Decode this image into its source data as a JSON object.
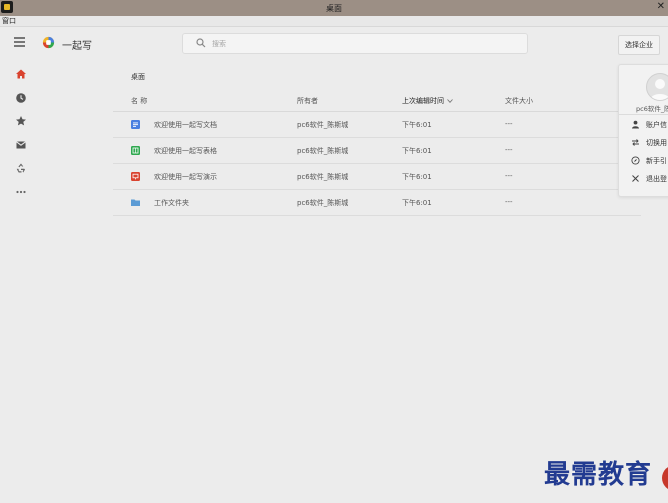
{
  "window": {
    "title": "桌面"
  },
  "menubar": {
    "items": [
      "窗口"
    ]
  },
  "header": {
    "app_name": "一起写",
    "search_placeholder": "搜索",
    "select_company_label": "选择企业"
  },
  "rail": {
    "items": [
      {
        "icon": "home-icon",
        "color": "#d9432f"
      },
      {
        "icon": "clock-icon",
        "color": "#555555"
      },
      {
        "icon": "star-icon",
        "color": "#555555"
      },
      {
        "icon": "mail-icon",
        "color": "#555555"
      },
      {
        "icon": "recycle-icon",
        "color": "#555555"
      },
      {
        "icon": "more-icon",
        "color": "#555555"
      }
    ]
  },
  "breadcrumb": "桌面",
  "table": {
    "columns": {
      "name": "名 称",
      "owner": "所有者",
      "modified": "上次编辑时间",
      "size": "文件大小"
    },
    "rows": [
      {
        "icon": "doc-icon",
        "color": "#4a7fe0",
        "name": "欢迎使用一起写文档",
        "owner": "pc6软件_陈斯城",
        "modified": "下午6:01",
        "size": "---"
      },
      {
        "icon": "sheet-icon",
        "color": "#2fa84f",
        "name": "欢迎使用一起写表格",
        "owner": "pc6软件_陈斯城",
        "modified": "下午6:01",
        "size": "---"
      },
      {
        "icon": "slides-icon",
        "color": "#d9432f",
        "name": "欢迎使用一起写演示",
        "owner": "pc6软件_陈斯城",
        "modified": "下午6:01",
        "size": "---"
      },
      {
        "icon": "folder-icon",
        "color": "#5b9bd5",
        "name": "工作文件夹",
        "owner": "pc6软件_陈斯城",
        "modified": "下午6:01",
        "size": "---"
      }
    ]
  },
  "user_menu": {
    "user_name": "pc6软件_陈",
    "items": [
      {
        "icon": "person-icon",
        "label": "账户信"
      },
      {
        "icon": "switch-icon",
        "label": "切换用"
      },
      {
        "icon": "guide-icon",
        "label": "新手引"
      },
      {
        "icon": "close-icon",
        "label": "退出登"
      }
    ]
  },
  "watermark": "最需教育"
}
